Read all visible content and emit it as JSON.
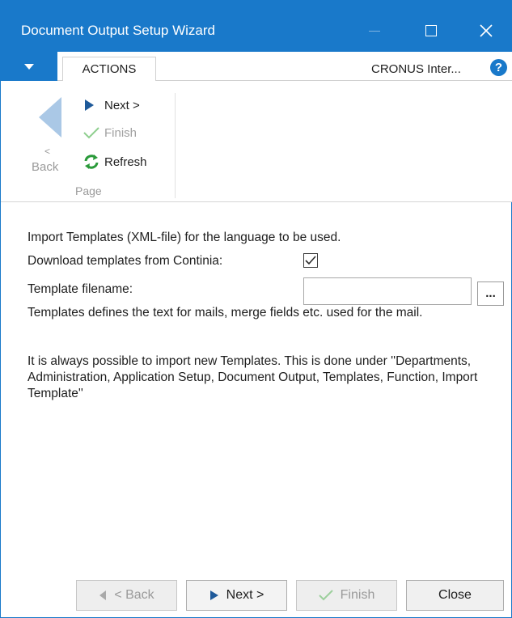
{
  "window": {
    "title": "Document Output Setup Wizard",
    "accent_color": "#1979ca"
  },
  "tabs": {
    "actions_label": "ACTIONS",
    "company": "CRONUS Inter...",
    "help_icon": "?"
  },
  "ribbon": {
    "back_arrow": "<",
    "back_label": "Back",
    "next_label": "Next >",
    "finish_label": "Finish",
    "refresh_label": "Refresh",
    "group_label": "Page"
  },
  "content": {
    "intro": "Import Templates (XML-file) for the language to be used.",
    "download_label": "Download templates from Continia:",
    "download_checked": true,
    "template_filename_label": "Template filename:",
    "template_filename_value": "",
    "browse_label": "...",
    "paragraph1": "Templates defines the text for mails, merge fields etc. used for the mail.",
    "paragraph2": "It is always possible to import new Templates. This is done under ''Departments, Administration, Application Setup, Document Output, Templates, Function, Import Template''"
  },
  "footer": {
    "back_label": "< Back",
    "next_label": "Next >",
    "finish_label": "Finish",
    "close_label": "Close"
  }
}
